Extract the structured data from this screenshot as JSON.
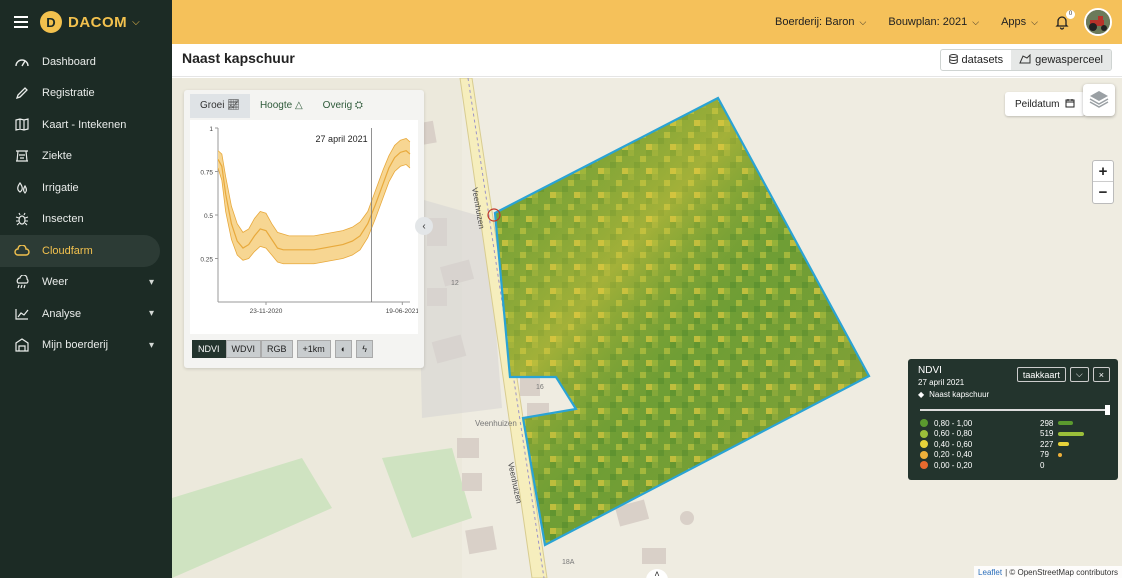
{
  "app": {
    "brand": "DACOM",
    "logo_letter": "D"
  },
  "sidebar": {
    "items": [
      {
        "label": "Dashboard",
        "icon": "dashboard-icon"
      },
      {
        "label": "Registratie",
        "icon": "pencil-icon"
      },
      {
        "label": "Kaart - Intekenen",
        "icon": "map-icon"
      },
      {
        "label": "Ziekte",
        "icon": "ziekte-icon"
      },
      {
        "label": "Irrigatie",
        "icon": "drops-icon"
      },
      {
        "label": "Insecten",
        "icon": "bug-icon"
      },
      {
        "label": "Cloudfarm",
        "icon": "cloud-icon",
        "active": true
      },
      {
        "label": "Weer",
        "icon": "weather-icon",
        "expandable": true
      },
      {
        "label": "Analyse",
        "icon": "chart-icon",
        "expandable": true
      },
      {
        "label": "Mijn boerderij",
        "icon": "farm-icon",
        "expandable": true
      }
    ]
  },
  "topbar": {
    "farm": "Boerderij: Baron",
    "plan": "Bouwplan: 2021",
    "apps": "Apps",
    "notifications": "0"
  },
  "page": {
    "title": "Naast kapschuur",
    "view_toggle": {
      "datasets": "datasets",
      "parcel": "gewasperceel"
    }
  },
  "chart_panel": {
    "tabs": [
      "Groei",
      "Hoogte",
      "Overig"
    ],
    "active_tab": "Groei",
    "buttons": [
      "NDVI",
      "WDVI",
      "RGB",
      "+1km"
    ],
    "active_button": "NDVI"
  },
  "chart_data": {
    "type": "area",
    "date_marker": "27 april 2021",
    "yticks": [
      "0.25",
      "0.5",
      "0.75",
      "1"
    ],
    "xticks": [
      "23-11-2020",
      "19-06-2021"
    ],
    "ylim": [
      0,
      1
    ],
    "xlabel": "",
    "ylabel": "",
    "x": [
      0,
      0.02,
      0.04,
      0.07,
      0.1,
      0.13,
      0.16,
      0.19,
      0.22,
      0.25,
      0.28,
      0.31,
      0.34,
      0.37,
      0.4,
      0.45,
      0.5,
      0.55,
      0.6,
      0.65,
      0.7,
      0.74,
      0.78,
      0.82,
      0.86,
      0.89,
      0.92,
      0.95,
      0.98,
      1.0
    ],
    "upper": [
      0.87,
      0.85,
      0.72,
      0.55,
      0.45,
      0.4,
      0.42,
      0.48,
      0.52,
      0.51,
      0.45,
      0.4,
      0.39,
      0.38,
      0.38,
      0.38,
      0.38,
      0.39,
      0.4,
      0.41,
      0.43,
      0.46,
      0.52,
      0.64,
      0.76,
      0.84,
      0.9,
      0.93,
      0.94,
      0.92
    ],
    "mean": [
      0.82,
      0.78,
      0.62,
      0.45,
      0.35,
      0.31,
      0.33,
      0.38,
      0.42,
      0.41,
      0.36,
      0.31,
      0.3,
      0.3,
      0.3,
      0.3,
      0.3,
      0.31,
      0.32,
      0.33,
      0.35,
      0.38,
      0.45,
      0.56,
      0.68,
      0.77,
      0.83,
      0.86,
      0.87,
      0.85
    ],
    "lower": [
      0.77,
      0.7,
      0.52,
      0.36,
      0.27,
      0.24,
      0.25,
      0.29,
      0.32,
      0.31,
      0.27,
      0.23,
      0.22,
      0.22,
      0.22,
      0.22,
      0.22,
      0.23,
      0.24,
      0.25,
      0.27,
      0.3,
      0.37,
      0.48,
      0.6,
      0.69,
      0.75,
      0.78,
      0.79,
      0.77
    ],
    "marker_x": 0.8,
    "colors": {
      "band": "#f7d692",
      "line": "#e8a93c"
    }
  },
  "map": {
    "peildatum": "Peildatum",
    "streets": [
      "Veenhuizen",
      "Veenhuizen",
      "Veenhuizen"
    ],
    "house_numbers": [
      "12",
      "16",
      "18A"
    ],
    "attribution_link": "Leaflet",
    "attribution_text": "| © OpenStreetMap contributors"
  },
  "legend": {
    "title": "NDVI",
    "date": "27 april 2021",
    "parcel": "Naast kapschuur",
    "taakkaart": "taakkaart",
    "classes": [
      {
        "range": "0,80 - 1,00",
        "count": 298,
        "color": "#5b9a2e"
      },
      {
        "range": "0,60 - 0,80",
        "count": 519,
        "color": "#9cbf3a"
      },
      {
        "range": "0,40 - 0,60",
        "count": 227,
        "color": "#e6d23a"
      },
      {
        "range": "0,20 - 0,40",
        "count": 79,
        "color": "#eeb03a"
      },
      {
        "range": "0,00 - 0,20",
        "count": 0,
        "color": "#e86a2e"
      }
    ]
  }
}
